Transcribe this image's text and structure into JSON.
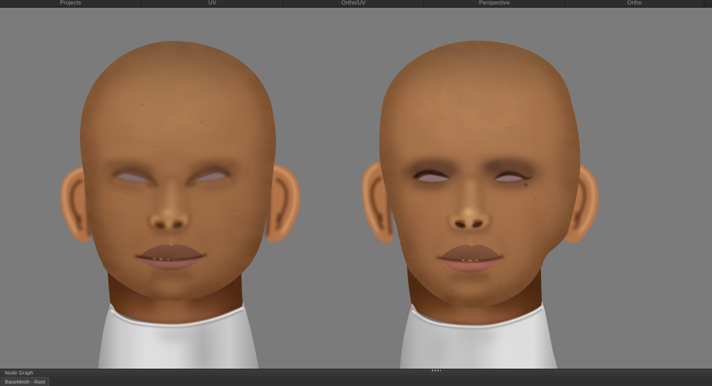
{
  "window": {
    "app_kind": "3d-character-texturing-workspace",
    "viewport_background": "#7b7b7b",
    "chrome_background": "#2e2e2e"
  },
  "tabbar": {
    "tabs": [
      {
        "label": "Projects"
      },
      {
        "label": "UV"
      },
      {
        "label": "Ortho/UV"
      },
      {
        "label": "Perspective"
      },
      {
        "label": "Ortho"
      }
    ]
  },
  "viewport": {
    "scene": "two bald textured head busts, front orthographic view",
    "heads": [
      {
        "id": "head-left",
        "description": "bald head, blank pale eyes, neutral look, white turtleneck bust",
        "skin_tone": "#a9734d",
        "eye_blank": "#a78b92",
        "collar": "#d2d2d2"
      },
      {
        "id": "head-right",
        "description": "bald head with dark eye make-up, beauty mark near right eye, rosy lips, white turtleneck bust",
        "skin_tone": "#b07a52",
        "eye_blank": "#ab8e96",
        "collar": "#d6d6d6"
      }
    ]
  },
  "node_graph": {
    "title": "Node Graph",
    "active_node_tab": "BaseMesh - Root"
  }
}
